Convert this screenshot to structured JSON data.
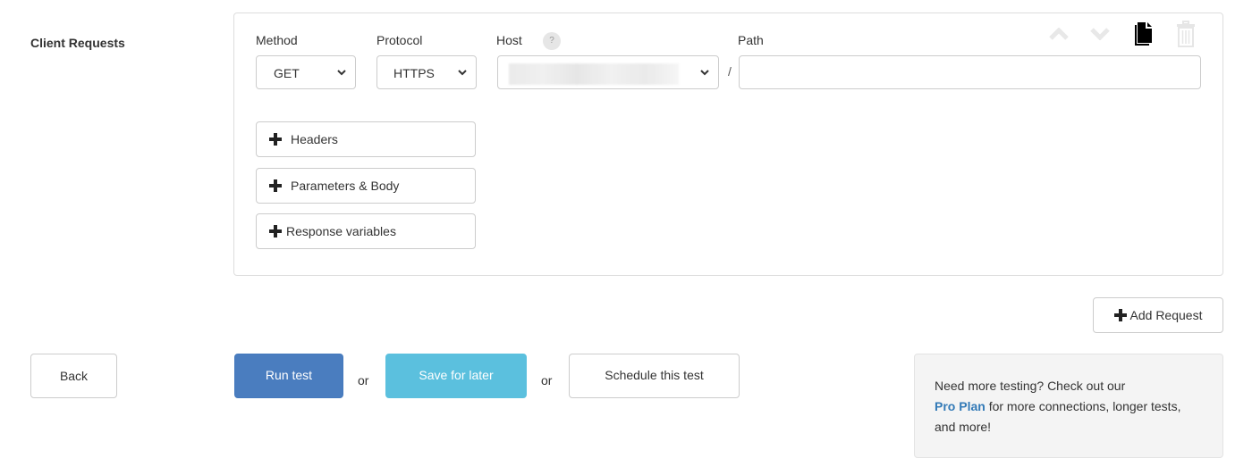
{
  "section": {
    "label": "Client Requests"
  },
  "request": {
    "method": {
      "label": "Method",
      "value": "GET"
    },
    "protocol": {
      "label": "Protocol",
      "value": "HTTPS"
    },
    "host": {
      "label": "Host",
      "help": "?",
      "value": ""
    },
    "path": {
      "label": "Path",
      "separator": "/",
      "value": "",
      "placeholder": ""
    },
    "toolbar": {
      "move_up": "chevron-up-icon",
      "move_down": "chevron-down-icon",
      "duplicate": "copy-icon",
      "delete": "trash-icon"
    },
    "expanders": [
      {
        "label": "Headers",
        "icon": "plus-icon"
      },
      {
        "label": "Parameters & Body",
        "icon": "plus-icon"
      },
      {
        "label": "Response variables",
        "icon": "plus-icon"
      }
    ]
  },
  "add_request": {
    "label": "Add Request",
    "icon": "plus-icon"
  },
  "actions": {
    "back": "Back",
    "run": "Run test",
    "or": "or",
    "save": "Save for later",
    "schedule": "Schedule this test"
  },
  "promo": {
    "before": "Need more testing? Check out our",
    "link": "Pro Plan",
    "after": "for more connections, longer tests, and more!"
  },
  "colors": {
    "primary": "#4a7dbf",
    "info": "#5bc0de",
    "link": "#337ab7"
  }
}
